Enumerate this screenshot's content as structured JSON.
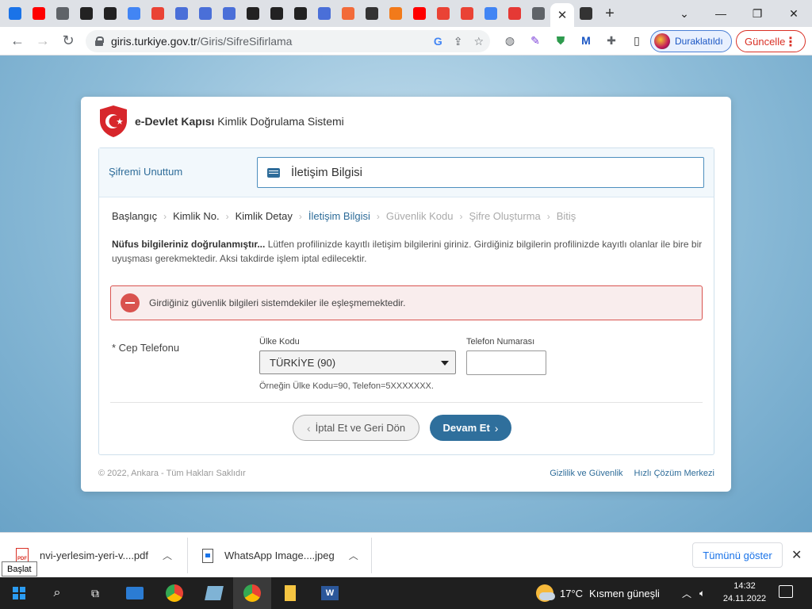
{
  "browser": {
    "favicons": [
      {
        "name": "chrome-icon",
        "color": "#1a73e8"
      },
      {
        "name": "youtube-icon",
        "color": "#ff0000"
      },
      {
        "name": "globe-icon",
        "color": "#5f6368"
      },
      {
        "name": "site-icon",
        "color": "#222222"
      },
      {
        "name": "site-icon",
        "color": "#222222"
      },
      {
        "name": "google-icon",
        "color": "#4285f4"
      },
      {
        "name": "gmail-icon",
        "color": "#ea4335"
      },
      {
        "name": "store-icon",
        "color": "#4a6fd8"
      },
      {
        "name": "store-icon",
        "color": "#4a6fd8"
      },
      {
        "name": "store-icon",
        "color": "#4a6fd8"
      },
      {
        "name": "site-icon",
        "color": "#222222"
      },
      {
        "name": "site-icon",
        "color": "#222222"
      },
      {
        "name": "site-icon",
        "color": "#222222"
      },
      {
        "name": "store-icon",
        "color": "#4a6fd8"
      },
      {
        "name": "dh-icon",
        "color": "#f26b3a"
      },
      {
        "name": "boot-icon",
        "color": "#333333"
      },
      {
        "name": "trendyol-icon",
        "color": "#f27a1a"
      },
      {
        "name": "youtube-icon",
        "color": "#ff0000"
      },
      {
        "name": "gmail-icon",
        "color": "#ea4335"
      },
      {
        "name": "gmail-icon",
        "color": "#ea4335"
      },
      {
        "name": "google-icon",
        "color": "#4285f4"
      },
      {
        "name": "record-icon",
        "color": "#e53935"
      },
      {
        "name": "globe-icon",
        "color": "#5f6368"
      }
    ],
    "active_tab_close": "✕",
    "new_tab": "+",
    "url_host": "giris.turkiye.gov.tr",
    "url_path": "/Giris/SifreSifirlama",
    "profile_label": "Duraklatıldı",
    "update_label": "Güncelle"
  },
  "page": {
    "brand_bold": "e-Devlet Kapısı",
    "brand_rest": " Kimlik Doğrulama Sistemi",
    "section_title": "Şifremi Unuttum",
    "step_title": "İletişim Bilgisi",
    "breadcrumb": [
      {
        "label": "Başlangıç",
        "state": "done"
      },
      {
        "label": "Kimlik No.",
        "state": "done"
      },
      {
        "label": "Kimlik Detay",
        "state": "done"
      },
      {
        "label": "İletişim Bilgisi",
        "state": "active"
      },
      {
        "label": "Güvenlik Kodu",
        "state": "future"
      },
      {
        "label": "Şifre Oluşturma",
        "state": "future"
      },
      {
        "label": "Bitiş",
        "state": "future"
      }
    ],
    "info_bold": "Nüfus bilgileriniz doğrulanmıştır...",
    "info_text": " Lütfen profilinizde kayıtlı iletişim bilgilerini giriniz. Girdiğiniz bilgilerin profilinizde kayıtlı olanlar ile bire bir uyuşması gerekmektedir. Aksi takdirde işlem iptal edilecektir.",
    "error_message": "Girdiğiniz güvenlik bilgileri sistemdekiler ile eşleşmemektedir.",
    "phone_field_label": "* Cep Telefonu",
    "country_label": "Ülke Kodu",
    "country_value": "TÜRKİYE (90)",
    "phone_label": "Telefon Numarası",
    "phone_value": "",
    "hint": "Örneğin Ülke Kodu=90, Telefon=5XXXXXXX.",
    "cancel_button": "İptal Et ve Geri Dön",
    "next_button": "Devam Et",
    "copyright": "© 2022, Ankara - Tüm Hakları Saklıdır",
    "footer_links": [
      "Gizlilik ve Güvenlik",
      "Hızlı Çözüm Merkezi"
    ]
  },
  "downloads": {
    "items": [
      "nvi-yerlesim-yeri-v....pdf",
      "WhatsApp Image....jpeg"
    ],
    "pdf_badge": "PDF",
    "show_all": "Tümünü göster",
    "close": "✕",
    "tooltip": "Başlat"
  },
  "taskbar": {
    "weather_temp": "17°C",
    "weather_text": "Kısmen güneşli",
    "time": "14:32",
    "date": "24.11.2022"
  },
  "colors": {
    "accent": "#2f6f9c",
    "error": "#d9534f",
    "link": "#2e6c99"
  }
}
